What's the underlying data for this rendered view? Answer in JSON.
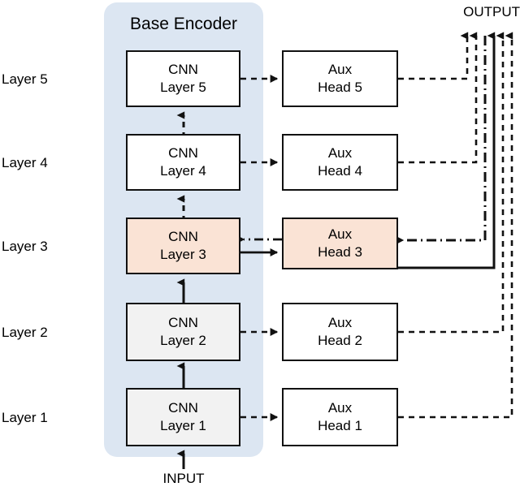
{
  "diagram": {
    "title_panel": "Base Encoder",
    "input_label": "INPUT",
    "output_label": "OUTPUT",
    "colors": {
      "encoder_panel": "#DCE6F2",
      "highlight_box": "#FAE3D5",
      "gray_box": "#F2F2F2",
      "white_box": "#FFFFFF",
      "stroke": "#111111",
      "background": "#FFFFFF"
    },
    "row_labels": [
      {
        "id": "layer-5",
        "text": "Layer 5"
      },
      {
        "id": "layer-4",
        "text": "Layer 4"
      },
      {
        "id": "layer-3",
        "text": "Layer 3"
      },
      {
        "id": "layer-2",
        "text": "Layer 2"
      },
      {
        "id": "layer-1",
        "text": "Layer 1"
      }
    ],
    "encoder_blocks": [
      {
        "id": "cnn-layer-5",
        "line1": "CNN",
        "line2": "Layer 5",
        "fill": "white"
      },
      {
        "id": "cnn-layer-4",
        "line1": "CNN",
        "line2": "Layer 4",
        "fill": "white"
      },
      {
        "id": "cnn-layer-3",
        "line1": "CNN",
        "line2": "Layer 3",
        "fill": "peach"
      },
      {
        "id": "cnn-layer-2",
        "line1": "CNN",
        "line2": "Layer 2",
        "fill": "gray"
      },
      {
        "id": "cnn-layer-1",
        "line1": "CNN",
        "line2": "Layer 1",
        "fill": "gray"
      }
    ],
    "aux_heads": [
      {
        "id": "aux-head-5",
        "line1": "Aux",
        "line2": "Head 5",
        "fill": "white"
      },
      {
        "id": "aux-head-4",
        "line1": "Aux",
        "line2": "Head 4",
        "fill": "white"
      },
      {
        "id": "aux-head-3",
        "line1": "Aux",
        "line2": "Head 3",
        "fill": "peach"
      },
      {
        "id": "aux-head-2",
        "line1": "Aux",
        "line2": "Head 2",
        "fill": "white"
      },
      {
        "id": "aux-head-1",
        "line1": "Aux",
        "line2": "Head 1",
        "fill": "white"
      }
    ],
    "connections": [
      {
        "id": "input-to-layer1",
        "style": "solid",
        "from": "INPUT",
        "to": "cnn-layer-1"
      },
      {
        "id": "layer1-to-layer2",
        "style": "solid",
        "from": "cnn-layer-1",
        "to": "cnn-layer-2"
      },
      {
        "id": "layer2-to-layer3",
        "style": "solid",
        "from": "cnn-layer-2",
        "to": "cnn-layer-3"
      },
      {
        "id": "layer3-to-layer4",
        "style": "dashed",
        "from": "cnn-layer-3",
        "to": "cnn-layer-4"
      },
      {
        "id": "layer4-to-layer5",
        "style": "dashed",
        "from": "cnn-layer-4",
        "to": "cnn-layer-5"
      },
      {
        "id": "layer1-to-head1",
        "style": "dashed",
        "from": "cnn-layer-1",
        "to": "aux-head-1"
      },
      {
        "id": "layer2-to-head2",
        "style": "dashed",
        "from": "cnn-layer-2",
        "to": "aux-head-2"
      },
      {
        "id": "layer3-to-head3",
        "style": "solid",
        "from": "cnn-layer-3",
        "to": "aux-head-3"
      },
      {
        "id": "head3-to-layer3",
        "style": "dash-dot",
        "from": "aux-head-3",
        "to": "cnn-layer-3"
      },
      {
        "id": "layer4-to-head4",
        "style": "dashed",
        "from": "cnn-layer-4",
        "to": "aux-head-4"
      },
      {
        "id": "layer5-to-head5",
        "style": "dashed",
        "from": "cnn-layer-5",
        "to": "aux-head-5"
      },
      {
        "id": "head5-to-output",
        "style": "dashed",
        "from": "aux-head-5",
        "to": "OUTPUT"
      },
      {
        "id": "head4-to-output",
        "style": "dashed",
        "from": "aux-head-4",
        "to": "OUTPUT"
      },
      {
        "id": "head3-to-output",
        "style": "solid",
        "from": "aux-head-3",
        "to": "OUTPUT"
      },
      {
        "id": "output-to-head3",
        "style": "dash-dot",
        "from": "OUTPUT",
        "to": "aux-head-3"
      },
      {
        "id": "head2-to-output",
        "style": "dashed",
        "from": "aux-head-2",
        "to": "OUTPUT"
      },
      {
        "id": "head1-to-output",
        "style": "dashed",
        "from": "aux-head-1",
        "to": "OUTPUT"
      }
    ]
  }
}
